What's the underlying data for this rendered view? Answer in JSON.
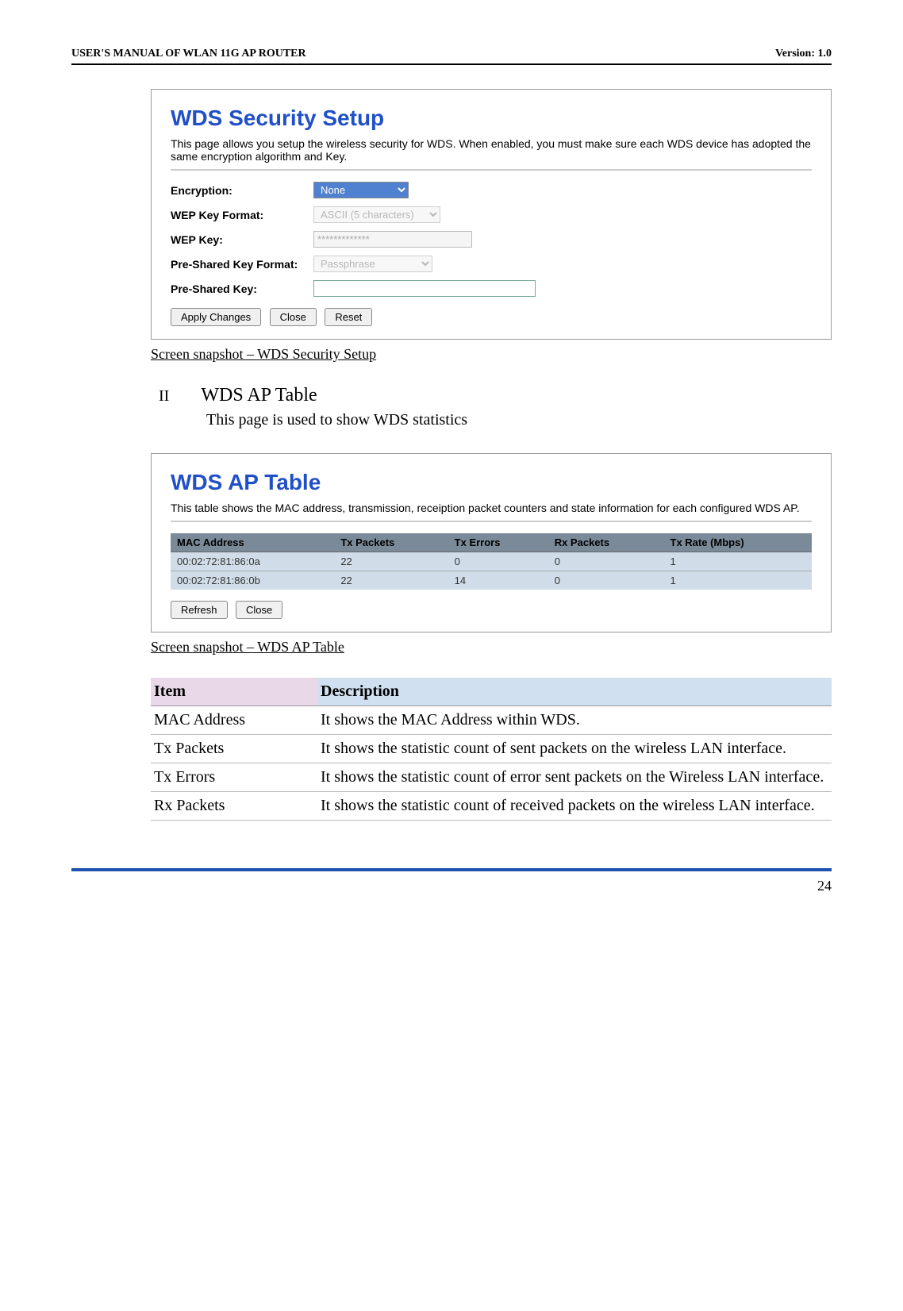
{
  "header": {
    "left": "USER'S MANUAL OF WLAN 11G AP ROUTER",
    "right": "Version: 1.0"
  },
  "panel1": {
    "title": "WDS Security Setup",
    "desc": "This page allows you setup the wireless security for WDS. When enabled, you must make sure each WDS device has adopted the same encryption algorithm and Key.",
    "rows": {
      "encryption_label": "Encryption:",
      "encryption_value": "None",
      "wepkeyfmt_label": "WEP Key Format:",
      "wepkeyfmt_value": "ASCII (5 characters)",
      "wepkey_label": "WEP Key:",
      "wepkey_value": "*************",
      "preshfmt_label": "Pre-Shared Key Format:",
      "preshfmt_value": "Passphrase",
      "preshkey_label": "Pre-Shared Key:",
      "preshkey_value": ""
    },
    "buttons": {
      "apply": "Apply Changes",
      "close": "Close",
      "reset": "Reset"
    }
  },
  "caption1": "Screen snapshot – WDS Security Setup",
  "section2": {
    "roman": "II",
    "title": "WDS AP Table",
    "body": "This page is used to show WDS statistics"
  },
  "panel2": {
    "title": "WDS AP Table",
    "desc": "This table shows the MAC address, transmission, receiption packet counters and state information for each configured WDS AP.",
    "headers": {
      "mac": "MAC Address",
      "txp": "Tx Packets",
      "txe": "Tx Errors",
      "rxp": "Rx Packets",
      "txr": "Tx Rate (Mbps)"
    },
    "rows": [
      {
        "mac": "00:02:72:81:86:0a",
        "txp": "22",
        "txe": "0",
        "rxp": "0",
        "txr": "1"
      },
      {
        "mac": "00:02:72:81:86:0b",
        "txp": "22",
        "txe": "14",
        "rxp": "0",
        "txr": "1"
      }
    ],
    "buttons": {
      "refresh": "Refresh",
      "close": "Close"
    }
  },
  "caption2": "Screen snapshot – WDS AP Table",
  "desc_table": {
    "headers": {
      "item": "Item",
      "desc": "Description"
    },
    "rows": [
      {
        "item": "MAC Address",
        "desc": "It shows the MAC Address within WDS."
      },
      {
        "item": "Tx Packets",
        "desc": "It shows the statistic count of sent packets on the wireless LAN interface."
      },
      {
        "item": "Tx Errors",
        "desc": "It shows the statistic count of error sent packets on the Wireless LAN interface."
      },
      {
        "item": "Rx Packets",
        "desc": "It shows the statistic count of received packets on the wireless LAN interface."
      }
    ]
  },
  "pagenum": "24"
}
